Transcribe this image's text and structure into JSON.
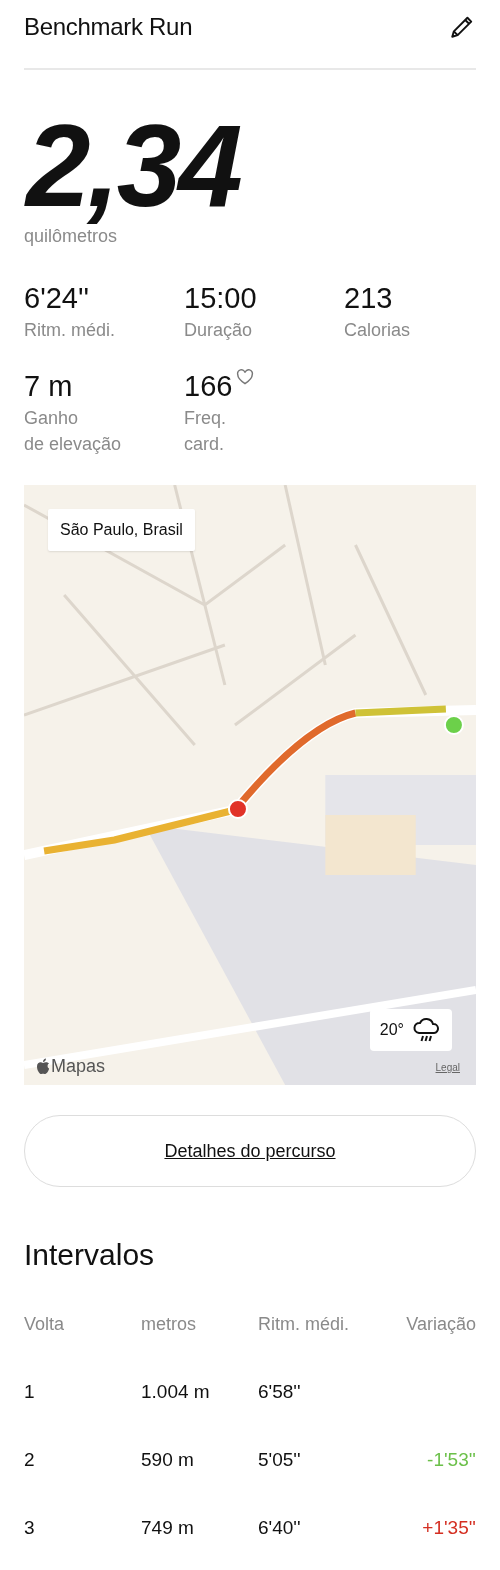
{
  "header": {
    "title": "Benchmark Run"
  },
  "distance": {
    "value": "2,34",
    "unit": "quilômetros"
  },
  "stats": [
    {
      "value": "6'24''",
      "label": "Ritm. médi.",
      "heart": false
    },
    {
      "value": "15:00",
      "label": "Duração",
      "heart": false
    },
    {
      "value": "213",
      "label": "Calorias",
      "heart": false
    },
    {
      "value": "7 m",
      "label": "Ganho\nde elevação",
      "heart": false
    },
    {
      "value": "166",
      "label": "Freq.\ncard.",
      "heart": true
    }
  ],
  "map": {
    "kind": "picture",
    "location": "São Paulo, Brasil",
    "temperature": "20°",
    "attribution": "Mapas",
    "legal": "Legal"
  },
  "route_button": "Detalhes do percurso",
  "intervals": {
    "title": "Intervalos",
    "columns": [
      "Volta",
      "metros",
      "Ritm. médi.",
      "Variação"
    ],
    "rows": [
      {
        "lap": "1",
        "distance": "1.004 m",
        "pace": "6'58''"
      },
      {
        "lap": "2",
        "distance": "590 m",
        "pace": "5'05''",
        "variation": {
          "text": "-1'53''",
          "color": "#6cc04a"
        }
      },
      {
        "lap": "3",
        "distance": "749 m",
        "pace": "6'40''",
        "variation": {
          "text": "+1'35''",
          "color": "#d42f22"
        }
      }
    ]
  }
}
